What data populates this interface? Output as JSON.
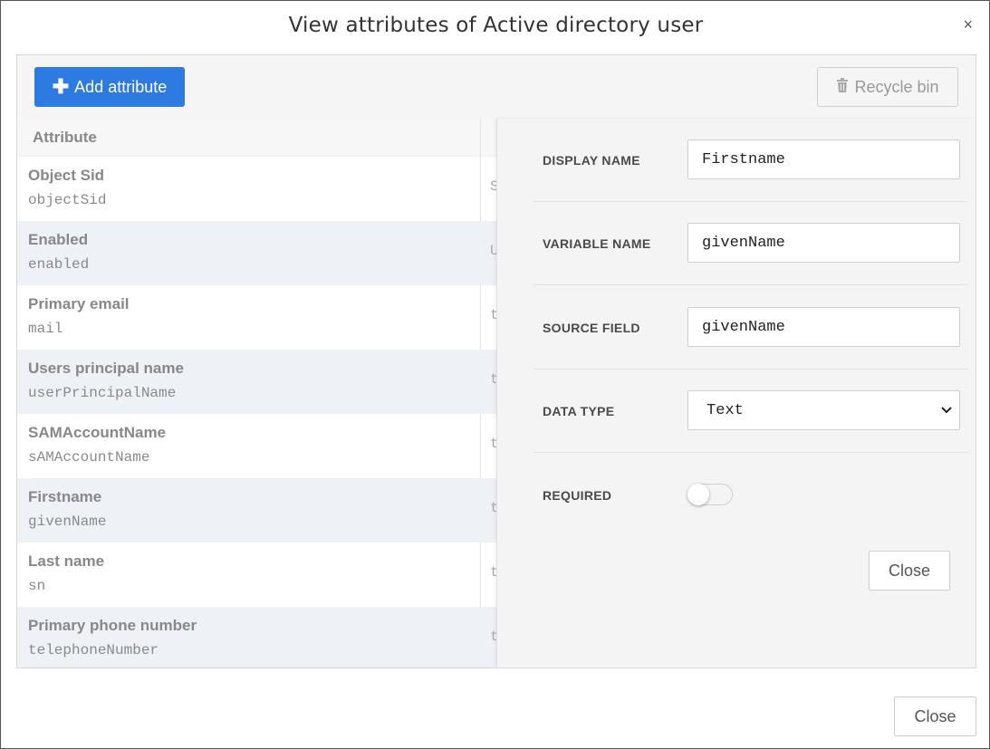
{
  "modal": {
    "title": "View attributes of Active directory user",
    "close_icon": "×",
    "footer_close_label": "Close"
  },
  "toolbar": {
    "add_icon": "plus-icon",
    "add_label": "Add attribute",
    "recycle_icon": "trash-icon",
    "recycle_label": "Recycle bin"
  },
  "table": {
    "header": "Attribute",
    "rows": [
      {
        "name": "Object Sid",
        "var": "objectSid",
        "frag": "S"
      },
      {
        "name": "Enabled",
        "var": "enabled",
        "frag": "U"
      },
      {
        "name": "Primary email",
        "var": "mail",
        "frag": "t"
      },
      {
        "name": "Users principal name",
        "var": "userPrincipalName",
        "frag": "t"
      },
      {
        "name": "SAMAccountName",
        "var": "sAMAccountName",
        "frag": "t"
      },
      {
        "name": "Firstname",
        "var": "givenName",
        "frag": "t"
      },
      {
        "name": "Last name",
        "var": "sn",
        "frag": "t"
      },
      {
        "name": "Primary phone number",
        "var": "telephoneNumber",
        "frag": "t"
      }
    ]
  },
  "detail": {
    "display_name_label": "DISPLAY NAME",
    "display_name_value": "Firstname",
    "variable_name_label": "VARIABLE NAME",
    "variable_name_value": "givenName",
    "source_field_label": "SOURCE FIELD",
    "source_field_value": "givenName",
    "data_type_label": "DATA TYPE",
    "data_type_value": "Text",
    "required_label": "REQUIRED",
    "required_on": false,
    "close_label": "Close"
  },
  "colors": {
    "primary": "#2d7be0",
    "row_alt": "#eef1f6"
  }
}
